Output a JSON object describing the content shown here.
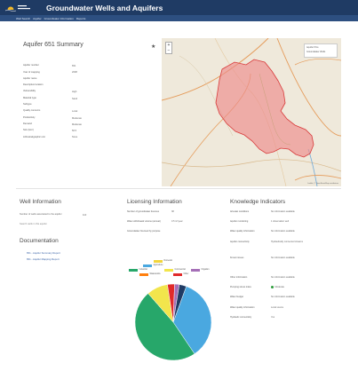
{
  "header": {
    "title": "Groundwater Wells and Aquifers",
    "nav": [
      "Well Search",
      "Aquifer",
      "Groundwater Information",
      "Reports"
    ]
  },
  "summary": {
    "title": "Aquifer 651 Summary",
    "rows": [
      {
        "k": "Aquifer number",
        "v": "651"
      },
      {
        "k": "Year of mapping",
        "v": "2008"
      },
      {
        "k": "Aquifer name",
        "v": ""
      },
      {
        "k": "Descriptive location",
        "v": ""
      },
      {
        "k": "Vulnerability",
        "v": "High"
      },
      {
        "k": "Material type",
        "v": "Sand"
      },
      {
        "k": "Subtype",
        "v": ""
      },
      {
        "k": "Quality concerns",
        "v": "Local"
      },
      {
        "k": "Productivity",
        "v": "Moderate"
      },
      {
        "k": "Demand",
        "v": "Moderate"
      },
      {
        "k": "Size (km²)",
        "v": "56.5"
      },
      {
        "k": "Lithostratigraphic unit",
        "v": "None"
      }
    ]
  },
  "map": {
    "zoom_in": "+",
    "zoom_out": "−",
    "layers": [
      "Aquifer Pins",
      "Groundwater Wells"
    ],
    "attribution": "Leaflet | © OpenStreetMap contributors"
  },
  "well_info": {
    "title": "Well Information",
    "rows": [
      {
        "k": "Number of wells associated to the aquifer",
        "v": "110"
      }
    ],
    "note": "Search wells in this aquifer"
  },
  "documentation": {
    "title": "Documentation",
    "links": [
      "651 - Aquifer Summary Report",
      "651 - Aquifer Mapping Report"
    ]
  },
  "licensing": {
    "title": "Licensing Information",
    "rows": [
      {
        "k": "Number of groundwater licences",
        "v": "38"
      },
      {
        "k": "Water withdrawal volume (annual)",
        "v": "0.5 m³/year"
      },
      {
        "k": "Groundwater licensed by purpose",
        "v": ""
      }
    ],
    "legend": [
      {
        "label": "Domestic",
        "color": "#f2d53c"
      },
      {
        "label": "Agriculture",
        "color": "#4aa8e0"
      },
      {
        "label": "Industrial",
        "color": "#27a76a"
      },
      {
        "label": "Commercial",
        "color": "#f2e54c"
      },
      {
        "label": "Irrigation",
        "color": "#a56fb7"
      },
      {
        "label": "Waterworks",
        "color": "#ff7f0e"
      },
      {
        "label": "Other",
        "color": "#e02a2a"
      }
    ]
  },
  "knowledge": {
    "title": "Knowledge Indicators",
    "rows": [
      {
        "k": "Artesian conditions",
        "v": "No information available",
        "lines": 2
      },
      {
        "k": "Aquifer monitoring",
        "v": "1 observation well",
        "lines": 2
      },
      {
        "k": "Water quality information",
        "v": "No information available",
        "lines": 2
      },
      {
        "k": "Aquifer connectivity",
        "v": "Hydraulically connected streams",
        "lines": 4
      },
      {
        "k": "Known issues",
        "v": "No information available",
        "lines": 5
      },
      {
        "k": "Other information",
        "v": "No information available",
        "lines": 2
      },
      {
        "k": "Pumping stress index",
        "v": "Moderate",
        "lines": 2,
        "dot": true
      },
      {
        "k": "Water budget",
        "v": "No information available",
        "lines": 2
      },
      {
        "k": "Water quality information",
        "v": "Local source",
        "lines": 2
      },
      {
        "k": "Hydraulic connectivity",
        "v": "Yes",
        "lines": 2
      }
    ]
  },
  "chart_data": {
    "type": "pie",
    "title": "",
    "slices": [
      {
        "label": "Agriculture",
        "value": 35,
        "color": "#4aa8e0"
      },
      {
        "label": "Industrial",
        "value": 48,
        "color": "#27a76a"
      },
      {
        "label": "Commercial",
        "value": 9,
        "color": "#f2e54c"
      },
      {
        "label": "Other",
        "value": 3,
        "color": "#e02a2a"
      },
      {
        "label": "Irrigation",
        "value": 2,
        "color": "#a56fb7"
      },
      {
        "label": "Domestic",
        "value": 3,
        "color": "#1f3b64"
      }
    ]
  }
}
